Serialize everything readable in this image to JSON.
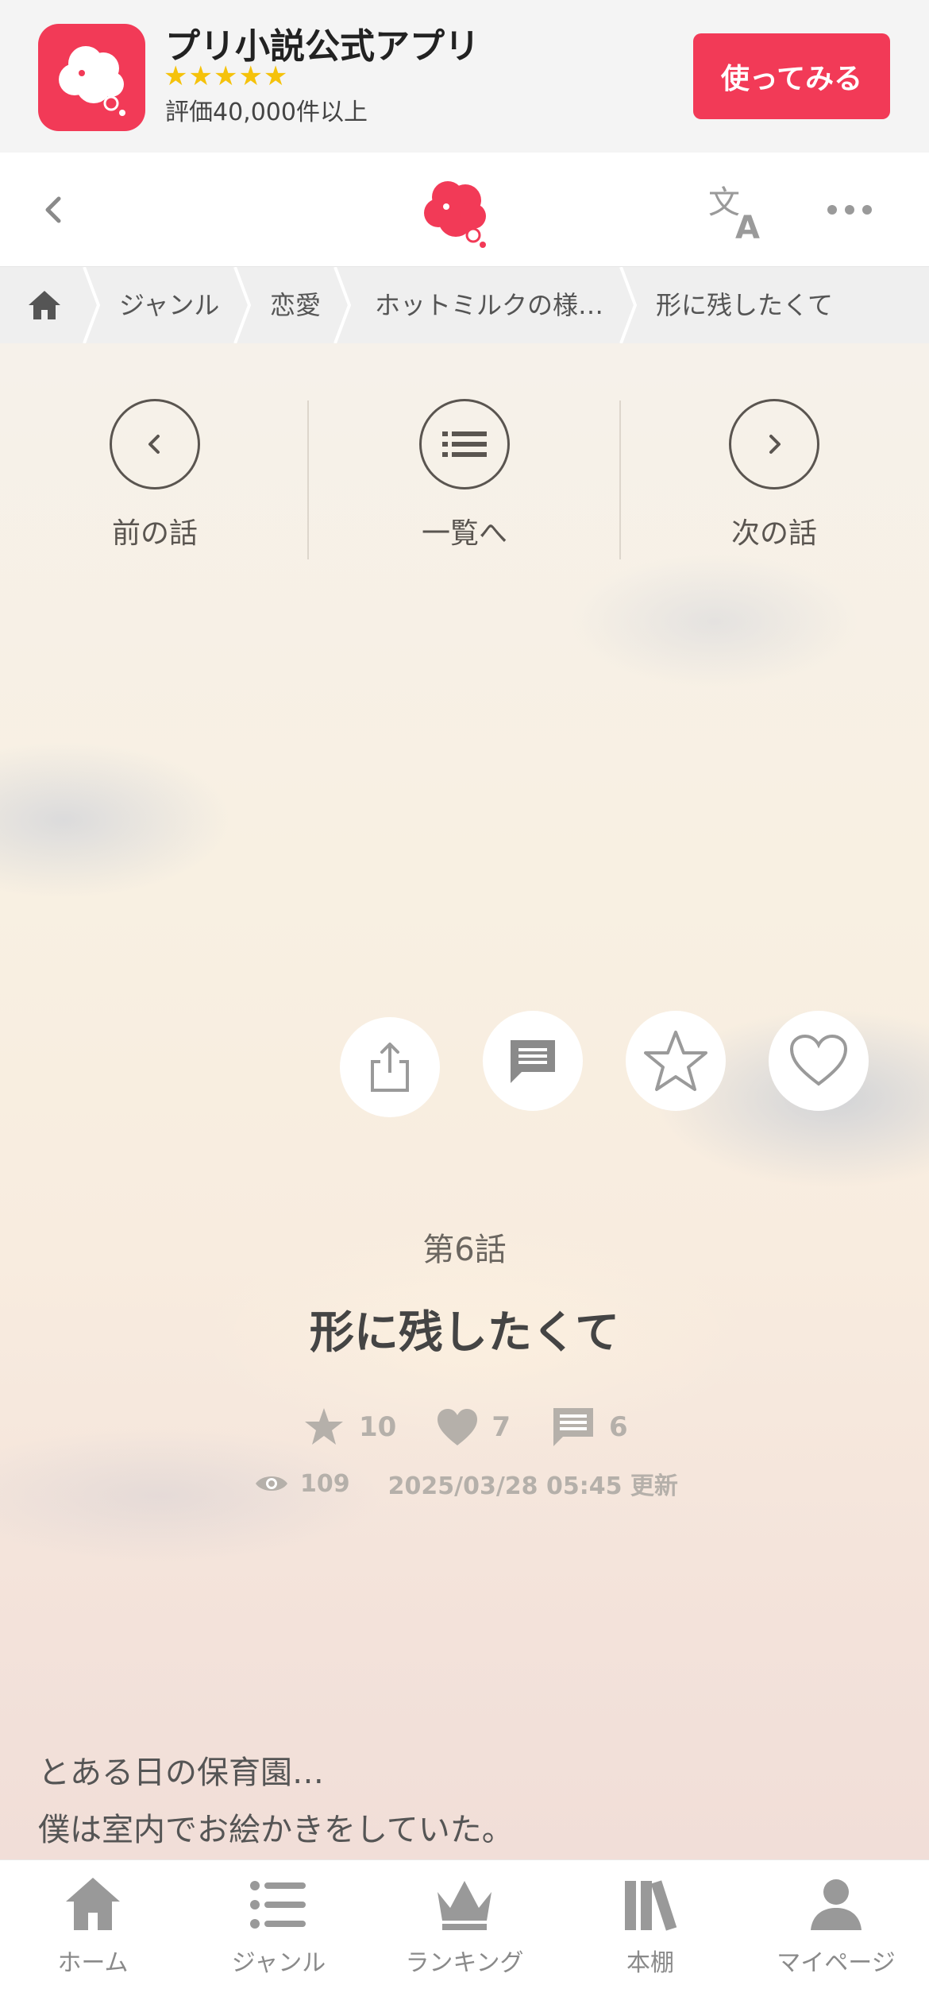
{
  "banner": {
    "app_name": "プリ小説公式アプリ",
    "stars": "★★★★★",
    "rating_text": "評価40,000件以上",
    "cta_label": "使ってみる",
    "accent": "#f23a57"
  },
  "header": {
    "icons": [
      "back-icon",
      "logo-icon",
      "translate-icon",
      "more-icon"
    ]
  },
  "breadcrumb": {
    "items": [
      "ジャンル",
      "恋愛",
      "ホットミルクの様…",
      "形に残したくて"
    ]
  },
  "episode_nav": {
    "prev_label": "前の話",
    "list_label": "一覧へ",
    "next_label": "次の話"
  },
  "actions": [
    "share-icon",
    "comment-icon",
    "star-icon",
    "heart-icon"
  ],
  "episode": {
    "number": "第6話",
    "title": "形に残したくて",
    "stars": "10",
    "hearts": "7",
    "comments": "6",
    "views": "109",
    "updated": "2025/03/28 05:45 更新"
  },
  "body": {
    "lines": [
      "とある日の保育園…",
      "僕は室内でお絵かきをしていた。"
    ]
  },
  "tabbar": {
    "items": [
      {
        "label": "ホーム",
        "icon": "home-icon"
      },
      {
        "label": "ジャンル",
        "icon": "list-icon"
      },
      {
        "label": "ランキング",
        "icon": "crown-icon"
      },
      {
        "label": "本棚",
        "icon": "bookshelf-icon"
      },
      {
        "label": "マイページ",
        "icon": "user-icon"
      }
    ]
  }
}
